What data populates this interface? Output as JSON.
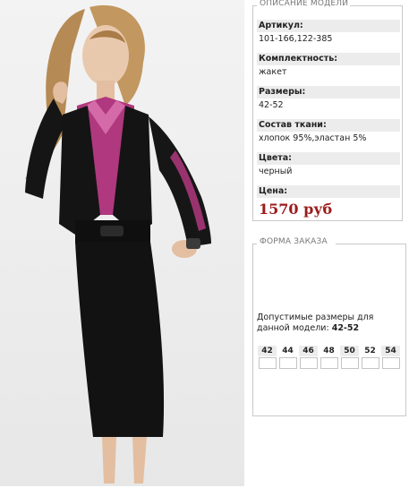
{
  "description": {
    "legend": "ОПИСАНИЕ МОДЕЛИ",
    "fields": [
      {
        "label": "Артикул:",
        "value": "101-166,122-385"
      },
      {
        "label": "Комплектность:",
        "value": "жакет"
      },
      {
        "label": "Размеры:",
        "value": "42-52"
      },
      {
        "label": "Состав ткани:",
        "value": "хлопок 95%,эластан 5%"
      },
      {
        "label": "Цвета:",
        "value": "черный"
      }
    ],
    "price_label": "Цена:",
    "price_value": "1570 руб"
  },
  "order": {
    "legend": "ФОРМА ЗАКАЗА",
    "text": "Допустимые размеры для данной модели:",
    "range": "42-52",
    "sizes": [
      "42",
      "44",
      "46",
      "48",
      "50",
      "52",
      "54"
    ]
  },
  "colors": {
    "price": "#9c1b1b",
    "label_bg": "#ececec",
    "border": "#c9c9c9",
    "accent_blouse": "#b0387e"
  }
}
